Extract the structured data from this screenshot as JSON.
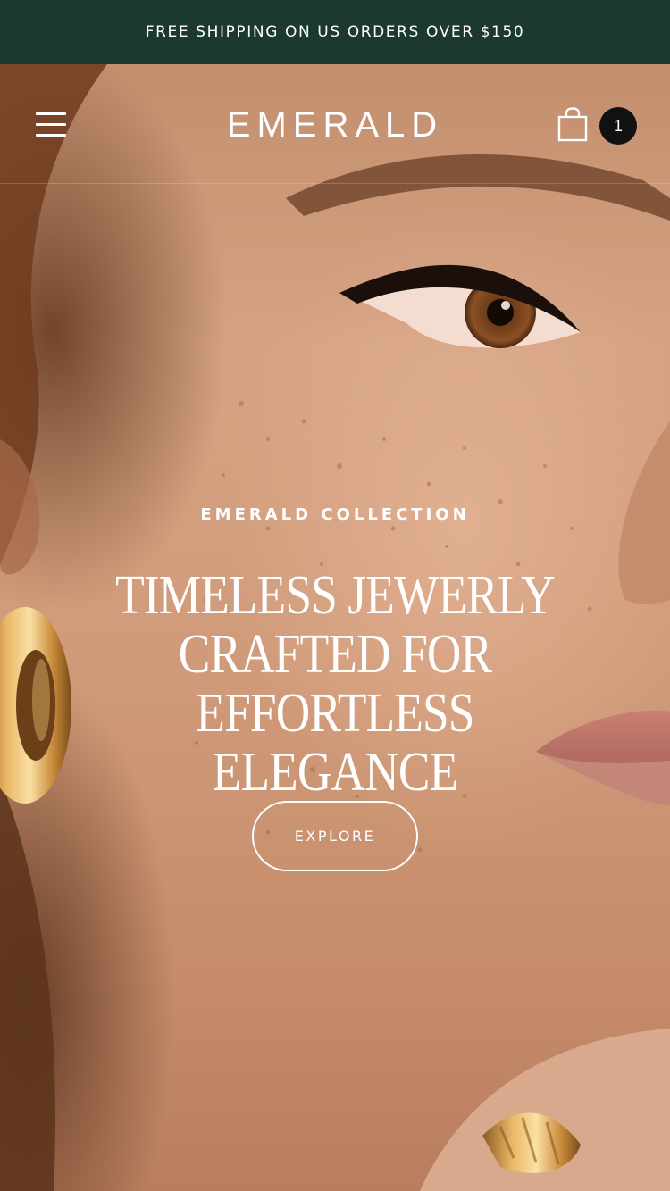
{
  "announcement": {
    "text": "FREE SHIPPING ON US ORDERS OVER $150"
  },
  "header": {
    "logo": "EMERALD",
    "menu_icon": "hamburger-menu-icon",
    "cart_icon": "shopping-bag-icon",
    "cart_count": "1"
  },
  "hero": {
    "eyebrow": "EMERALD COLLECTION",
    "title": "TIMELESS JEWERLY\nCRAFTED FOR EFFORTLESS\nELEGANCE",
    "button_label": "EXPLORE",
    "image_subject": "close-up of woman's face with gold hoop earring and gold ring"
  },
  "colors": {
    "announcement_bg": "#1b392f",
    "text": "#ffffff",
    "cart_badge_bg": "#111111",
    "skin": "#d5a383",
    "gold": "#d8a24e"
  }
}
